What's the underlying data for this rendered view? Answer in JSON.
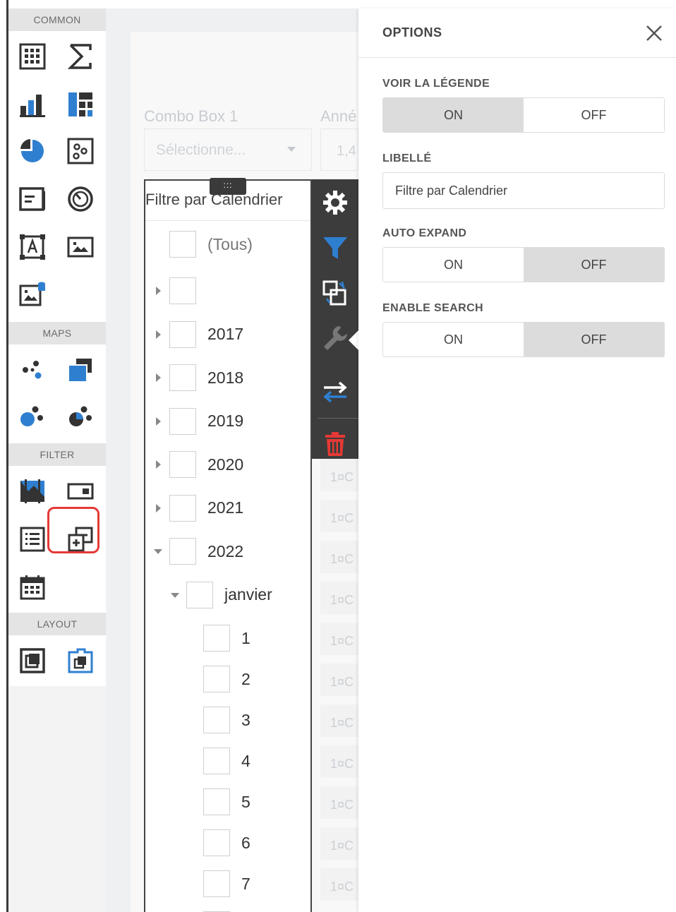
{
  "toolbox": {
    "sections": {
      "common": "COMMON",
      "maps": "MAPS",
      "filter": "FILTER",
      "layout": "LAYOUT"
    },
    "icons": [
      "grid-icon",
      "sum-icon",
      "bar-chart-icon",
      "treemap-icon",
      "pie-chart-icon",
      "scatter-icon",
      "card-icon",
      "gauge-icon",
      "text-box-icon",
      "image-icon",
      "bound-image-icon",
      "geo-point-map-icon",
      "choropleth-map-icon",
      "bubble-map-icon",
      "pie-map-icon",
      "range-filter-icon",
      "combo-box-icon",
      "list-box-icon",
      "tree-view-icon",
      "date-filter-icon",
      "group-icon",
      "tab-container-icon"
    ],
    "highlight_color": "#e53935"
  },
  "canvas": {
    "combo": {
      "caption": "Combo Box 1",
      "placeholder": "Sélectionne..."
    },
    "annee": {
      "caption": "Anné",
      "value": "1,4"
    },
    "treeview": {
      "caption": "Filtre par Calendrier",
      "all_label": "(Tous)",
      "nodes": [
        {
          "label": "",
          "level": 0,
          "expander": "right"
        },
        {
          "label": "2017",
          "level": 0,
          "expander": "right"
        },
        {
          "label": "2018",
          "level": 0,
          "expander": "right"
        },
        {
          "label": "2019",
          "level": 0,
          "expander": "right"
        },
        {
          "label": "2020",
          "level": 0,
          "expander": "right"
        },
        {
          "label": "2021",
          "level": 0,
          "expander": "right"
        },
        {
          "label": "2022",
          "level": 0,
          "expander": "down"
        },
        {
          "label": "janvier",
          "level": 1,
          "expander": "down"
        },
        {
          "label": "1",
          "level": 2
        },
        {
          "label": "2",
          "level": 2
        },
        {
          "label": "3",
          "level": 2
        },
        {
          "label": "4",
          "level": 2
        },
        {
          "label": "5",
          "level": 2
        },
        {
          "label": "6",
          "level": 2
        },
        {
          "label": "7",
          "level": 2
        },
        {
          "label": "",
          "level": 2
        }
      ]
    },
    "drag_handle": ":::",
    "side_toolbar": [
      "gear-icon",
      "filter-icon",
      "convert-icon",
      "wrench-icon",
      "swap-icon",
      "delete-icon"
    ],
    "grid_cells": [
      "1¤C",
      "1¤C",
      "1¤C",
      "1¤C",
      "1¤C",
      "1¤C",
      "1¤C",
      "1¤C",
      "1¤C",
      "1¤C",
      "1¤C"
    ],
    "accent_color": "#2f7fd0",
    "delete_color": "#e53935"
  },
  "options": {
    "title": "OPTIONS",
    "close_icon": "close-icon",
    "show_legend": {
      "label": "VOIR LA LÉGENDE",
      "on": "ON",
      "off": "OFF",
      "selected": "ON"
    },
    "caption": {
      "label": "LIBELLÉ",
      "value": "Filtre par Calendrier"
    },
    "auto_expand": {
      "label": "AUTO EXPAND",
      "on": "ON",
      "off": "OFF",
      "selected": "OFF"
    },
    "enable_search": {
      "label": "ENABLE SEARCH",
      "on": "ON",
      "off": "OFF",
      "selected": "OFF"
    }
  }
}
